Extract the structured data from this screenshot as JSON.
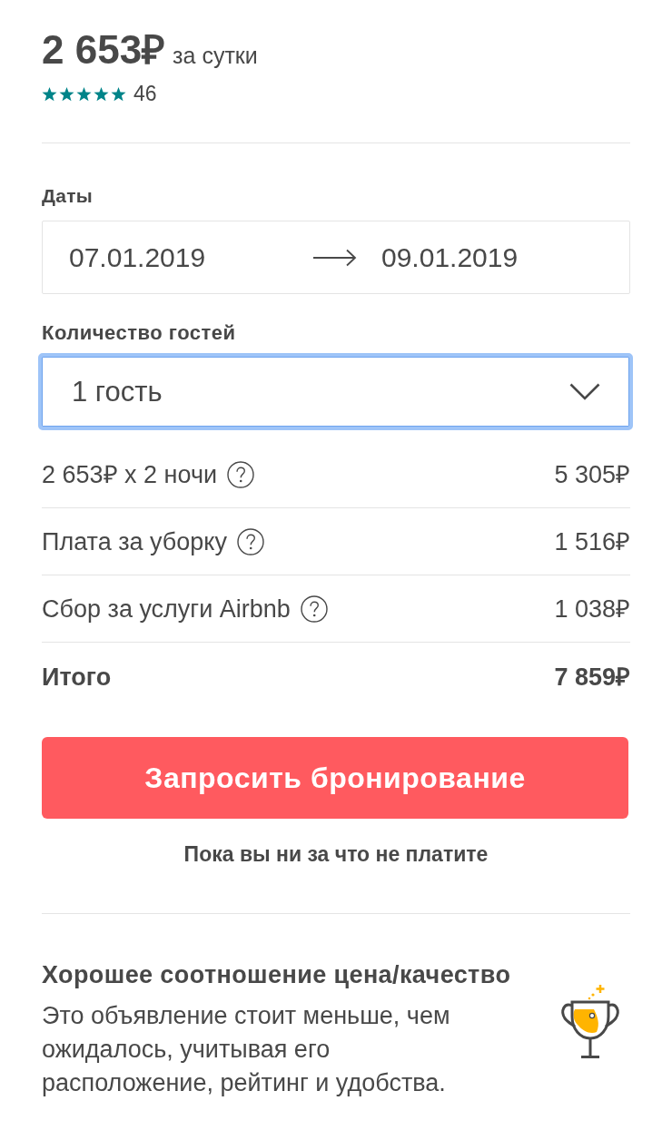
{
  "price": {
    "amount": "2 653₽",
    "period": "за сутки"
  },
  "rating": {
    "stars": 5,
    "count": "46"
  },
  "dates": {
    "label": "Даты",
    "start": "07.01.2019",
    "end": "09.01.2019"
  },
  "guests": {
    "label": "Количество гостей",
    "value": "1 гость",
    "focused": true
  },
  "price_lines": [
    {
      "kind": "line",
      "label": "2 653₽ x 2 ночи",
      "help": true,
      "amount": "5 305₽"
    },
    {
      "kind": "line",
      "label": "Плата за уборку",
      "help": true,
      "amount": "1 516₽"
    },
    {
      "kind": "line",
      "label": "Сбор за услуги Airbnb",
      "help": true,
      "amount": "1 038₽"
    },
    {
      "kind": "total",
      "label": "Итого",
      "help": false,
      "amount": "7 859₽"
    }
  ],
  "book_button": "Запросить бронирование",
  "note": "Пока вы ни за что не платите",
  "highlight": {
    "title": "Хорошее соотношение цена/качество",
    "text": "Это объявление стоит меньше, чем ожидалось, учитывая его расположение, рейтинг и удобства."
  }
}
